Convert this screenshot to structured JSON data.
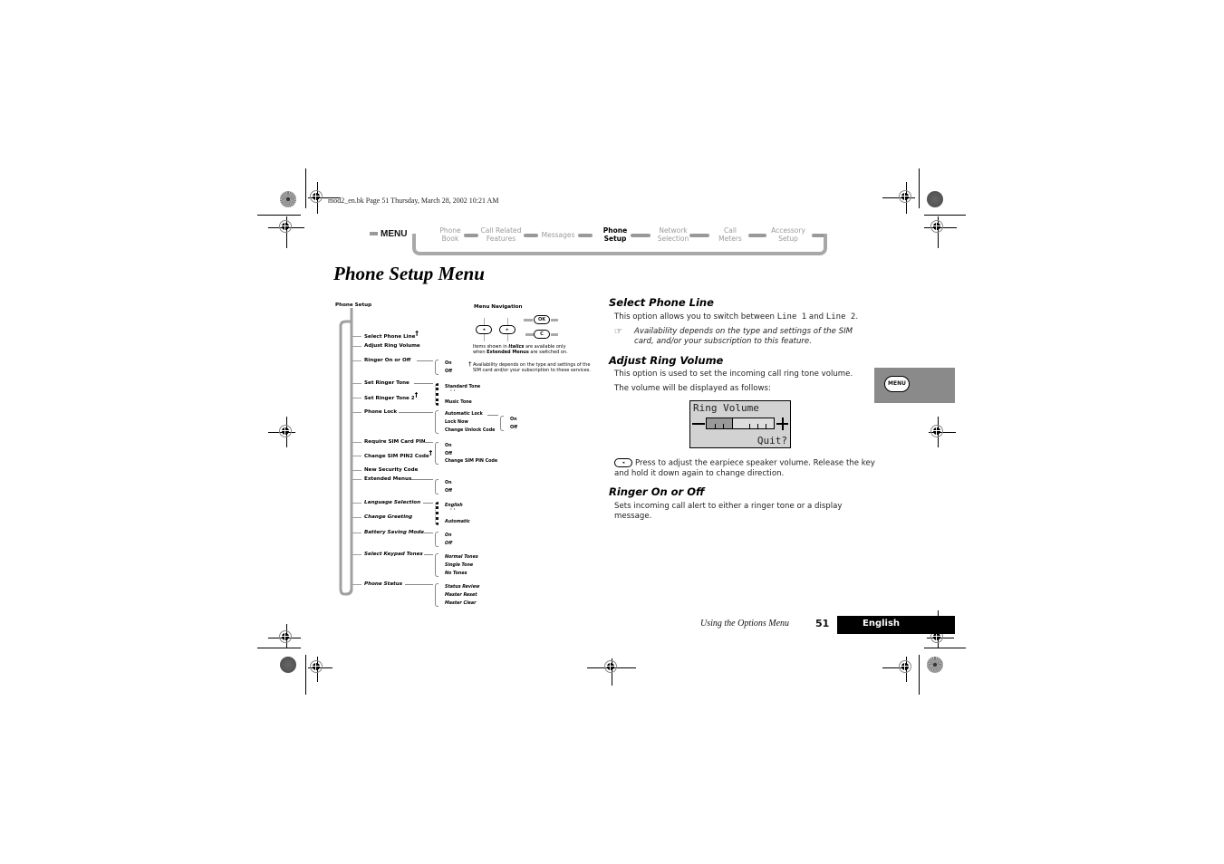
{
  "slug": "mod2_en.bk  Page 51  Thursday, March 28, 2002  10:21 AM",
  "nav": {
    "menu_label": "MENU",
    "items": [
      {
        "line1": "Phone",
        "line2": "Book",
        "active": false
      },
      {
        "line1": "Call Related",
        "line2": "Features",
        "active": false
      },
      {
        "line1": "Messages",
        "line2": "",
        "active": false
      },
      {
        "line1": "Phone",
        "line2": "Setup",
        "active": true
      },
      {
        "line1": "Network",
        "line2": "Selection",
        "active": false
      },
      {
        "line1": "Call",
        "line2": "Meters",
        "active": false
      },
      {
        "line1": "Accessory",
        "line2": "Setup",
        "active": false
      }
    ]
  },
  "page_title": "Phone Setup Menu",
  "tree": {
    "root": "Phone Setup",
    "items": [
      {
        "label": "Select Phone Line",
        "dagger": true,
        "italic": false
      },
      {
        "label": "Adjust Ring Volume",
        "italic": false
      },
      {
        "label": "Ringer On or Off",
        "italic": false,
        "options": [
          "On",
          "Off"
        ]
      },
      {
        "label": "Set Ringer Tone",
        "italic": false,
        "options": [
          "Standard Tone",
          "Music Tone"
        ]
      },
      {
        "label": "Set Ringer Tone 2",
        "dagger": true,
        "italic": false
      },
      {
        "label": "Phone Lock",
        "italic": false,
        "options": [
          "Automatic Lock",
          "Lock Now",
          "Change Unlock Code"
        ],
        "sub_options": [
          "On",
          "Off"
        ]
      },
      {
        "label": "Require SIM Card PIN",
        "italic": false,
        "options": [
          "On",
          "Off",
          "Change SIM PIN Code"
        ]
      },
      {
        "label": "Change SIM PIN2 Code",
        "dagger": true,
        "italic": false
      },
      {
        "label": "New Security Code",
        "italic": false
      },
      {
        "label": "Extended Menus",
        "italic": false,
        "options": [
          "On",
          "Off"
        ]
      },
      {
        "label": "Language Selection",
        "italic": true,
        "options": [
          "English",
          "Automatic"
        ]
      },
      {
        "label": "Change Greeting",
        "italic": true
      },
      {
        "label": "Battery Saving Mode",
        "italic": true,
        "options": [
          "On",
          "Off"
        ]
      },
      {
        "label": "Select Keypad Tones",
        "italic": true,
        "options": [
          "Normal Tones",
          "Single Tone",
          "No Tones"
        ]
      },
      {
        "label": "Phone Status",
        "italic": true,
        "options": [
          "Status Review",
          "Master Reset",
          "Master Clear"
        ]
      }
    ],
    "legend": {
      "title": "Menu Navigation",
      "ok_key": "OK",
      "c_key": "C",
      "note_line1_a": "Items shown in ",
      "note_line1_b": "Italics",
      "note_line1_c": " are available only",
      "note_line2_a": "when ",
      "note_line2_b": "Extended Menus",
      "note_line2_c": " are switched on.",
      "dagger_note_1": "Availability depends on the type and settings of the",
      "dagger_note_2": "SIM card and/or your subscription to these services."
    }
  },
  "sections": {
    "select_phone_line": {
      "heading": "Select Phone Line",
      "body_a": "This option allows you to switch between ",
      "line1": "Line 1",
      "body_b": " and ",
      "line2": "Line 2",
      "body_c": ".",
      "note_1": "Availability depends on the type and settings of the SIM",
      "note_2": "card, and/or your subscription to this feature."
    },
    "adjust_ring_volume": {
      "heading": "Adjust Ring Volume",
      "body_1": "This option is used to set the incoming call ring tone volume.",
      "body_2": "The volume will be displayed as follows:",
      "lcd_title": "Ring Volume",
      "lcd_quit": "Quit?",
      "volume_level": 0.375,
      "key_text_1": "Press to adjust the earpiece speaker volume. Release the key",
      "key_text_2": "and hold it down again to change direction."
    },
    "ringer_on_off": {
      "heading": "Ringer On or Off",
      "body_1": "Sets incoming call alert to either a ringer tone or a display",
      "body_2": "message."
    }
  },
  "side_tab": {
    "label": "MENU"
  },
  "footer": {
    "section": "Using the Options Menu",
    "page": "51",
    "language": "English"
  }
}
